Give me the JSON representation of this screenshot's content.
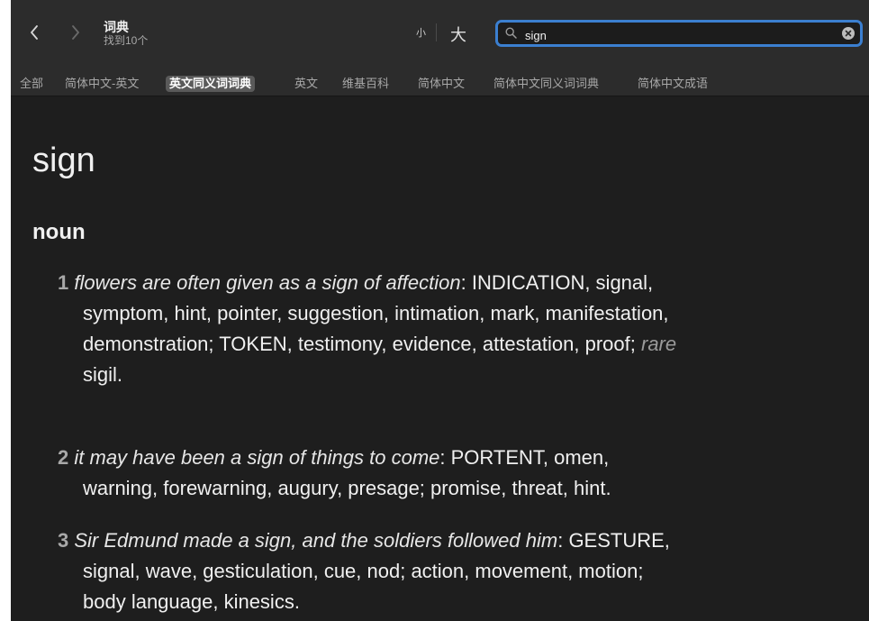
{
  "window": {
    "title": "词典",
    "subtitle": "找到10个"
  },
  "toolbar": {
    "font_small": "小",
    "font_large": "大"
  },
  "search": {
    "value": "sign",
    "placeholder": ""
  },
  "tabs": [
    {
      "label": "全部",
      "active": false
    },
    {
      "label": "简体中文-英文",
      "active": false
    },
    {
      "label": "英文同义词词典",
      "active": true
    },
    {
      "label": "英文",
      "active": false
    },
    {
      "label": "维基百科",
      "active": false
    },
    {
      "label": "简体中文",
      "active": false
    },
    {
      "label": "简体中文同义词词典",
      "active": false
    },
    {
      "label": "简体中文成语",
      "active": false
    }
  ],
  "entry": {
    "headword": "sign",
    "part_of_speech": "noun",
    "senses": [
      {
        "number": "1",
        "example": "flowers are often given as a sign of affection",
        "line1_syn": ": INDICATION, signal,",
        "line2": "symptom, hint, pointer, suggestion, intimation, mark, manifestation,",
        "line3": "demonstration; TOKEN, testimony, evidence, attestation, proof; ",
        "register": "rare",
        "line4": "sigil."
      },
      {
        "number": "2",
        "example": "it may have been a sign of things to come",
        "line1_syn": ": PORTENT, omen,",
        "line2": "warning, forewarning, augury, presage; promise, threat, hint."
      },
      {
        "number": "3",
        "example": "Sir Edmund made a sign, and the soldiers followed him",
        "line1_syn": ": GESTURE,",
        "line2": "signal, wave, gesticulation, cue, nod; action, movement, motion;",
        "line3": "body language, kinesics."
      }
    ]
  },
  "colors": {
    "background": "#1e1e1e",
    "toolbar": "#2c2c2c",
    "search_focus": "#3b7fd0",
    "active_tab": "#5a5a5a"
  }
}
